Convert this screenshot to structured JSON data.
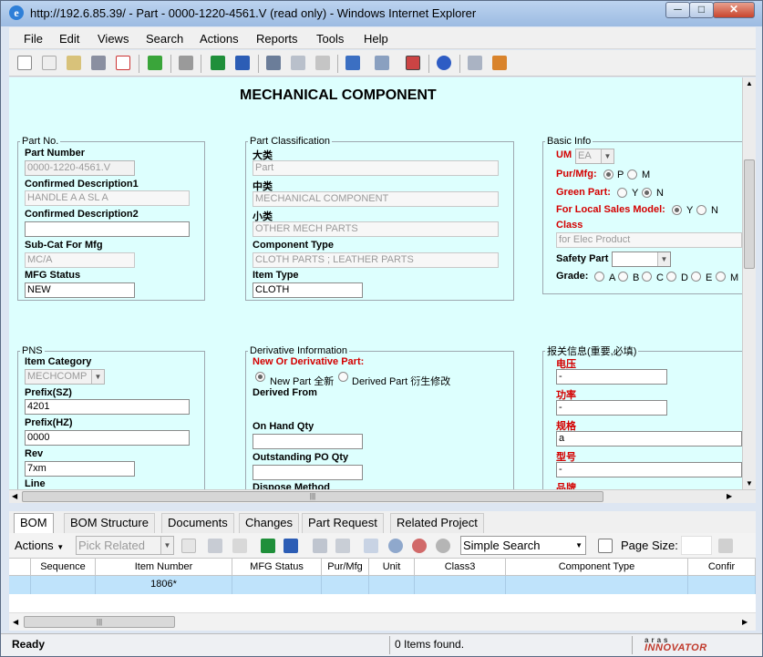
{
  "window": {
    "title": "http://192.6.85.39/ - Part - 0000-1220-4561.V (read only) - Windows Internet Explorer",
    "ie_glyph": "e",
    "min": "─",
    "max": "□",
    "close": "✕"
  },
  "menu": [
    "File",
    "Edit",
    "Views",
    "Search",
    "Actions",
    "Reports",
    "Tools",
    "Help"
  ],
  "toolbar_icons": [
    "new-document-icon",
    "view-icon",
    "open-folder-icon",
    "save-icon",
    "delete-icon",
    "refresh-icon",
    "print-icon",
    "excel-icon",
    "word-icon",
    "lock-icon",
    "unlock-icon",
    "undo-icon",
    "promote-icon",
    "where-used-icon",
    "structure-browser-icon",
    "help-icon",
    "unclaim-icon",
    "exit-icon"
  ],
  "form": {
    "heading": "MECHANICAL COMPONENT",
    "part_no": {
      "legend": "Part No.",
      "part_number_label": "Part Number",
      "part_number": "0000-1220-4561.V",
      "desc1_label": "Confirmed Description1",
      "desc1": "HANDLE A A SL A",
      "desc2_label": "Confirmed Description2",
      "desc2": "",
      "subcat_label": "Sub-Cat For Mfg",
      "subcat": "MC/A",
      "mfg_status_label": "MFG Status",
      "mfg_status": "NEW"
    },
    "classification": {
      "legend": "Part Classification",
      "big_label": "大类",
      "big": "Part",
      "mid_label": "中类",
      "mid": "MECHANICAL COMPONENT",
      "small_label": "小类",
      "small": "OTHER MECH PARTS",
      "component_type_label": "Component Type",
      "component_type": "CLOTH PARTS ; LEATHER PARTS",
      "item_type_label": "Item Type",
      "item_type": "CLOTH"
    },
    "basic": {
      "legend": "Basic Info",
      "um_label": "UM",
      "um": "EA",
      "pur_label": "Pur/Mfg:",
      "pur_p": "P",
      "pur_m": "M",
      "green_label": "Green Part:",
      "green_y": "Y",
      "green_n": "N",
      "local_label": "For Local Sales Model:",
      "local_y": "Y",
      "local_n": "N",
      "class_label": "Class",
      "class_value": "for Elec Product",
      "safety_label": "Safety Part",
      "grade_label": "Grade:",
      "grades": [
        "A",
        "B",
        "C",
        "D",
        "E",
        "M"
      ]
    },
    "pns": {
      "legend": "PNS",
      "item_category_label": "Item Category",
      "item_category": "MECHCOMP",
      "prefix_sz_label": "Prefix(SZ)",
      "prefix_sz": "4201",
      "prefix_hz_label": "Prefix(HZ)",
      "prefix_hz": "0000",
      "rev_label": "Rev",
      "rev": "7xm",
      "line_label": "Line"
    },
    "derivative": {
      "legend": "Derivative Information",
      "new_or_derivative_label": "New Or Derivative Part:",
      "new_part": "New Part 全新",
      "derived_part": "Derived Part 衍生修改",
      "derived_from_label": "Derived From",
      "on_hand_label": "On Hand Qty",
      "outstanding_label": "Outstanding PO Qty",
      "dispose_label": "Dispose Method"
    },
    "customs": {
      "legend": "报关信息(重要,必填)",
      "voltage_label": "电压",
      "voltage": "-",
      "power_label": "功率",
      "power": "-",
      "spec_label": "规格",
      "spec": "a",
      "model_label": "型号",
      "model": "-",
      "brand_label": "品牌"
    }
  },
  "tabs": [
    "BOM",
    "BOM Structure",
    "Documents",
    "Changes",
    "Part Request",
    "Related Project"
  ],
  "relationship_toolbar": {
    "actions": "Actions",
    "pick_related": "Pick Related",
    "search_mode": "Simple Search",
    "page_size_label": "Page Size:",
    "page_size": ""
  },
  "grid": {
    "columns": [
      "Sequence",
      "Item Number",
      "MFG Status",
      "Pur/Mfg",
      "Unit",
      "Class3",
      "Component Type",
      "Confir"
    ],
    "rows": [
      [
        "",
        "1806*",
        "",
        "",
        "",
        "",
        "",
        ""
      ]
    ]
  },
  "status": {
    "ready": "Ready",
    "items_found": "0 Items found.",
    "logo_top": "aras",
    "logo_bottom": "INNOVATOR"
  }
}
